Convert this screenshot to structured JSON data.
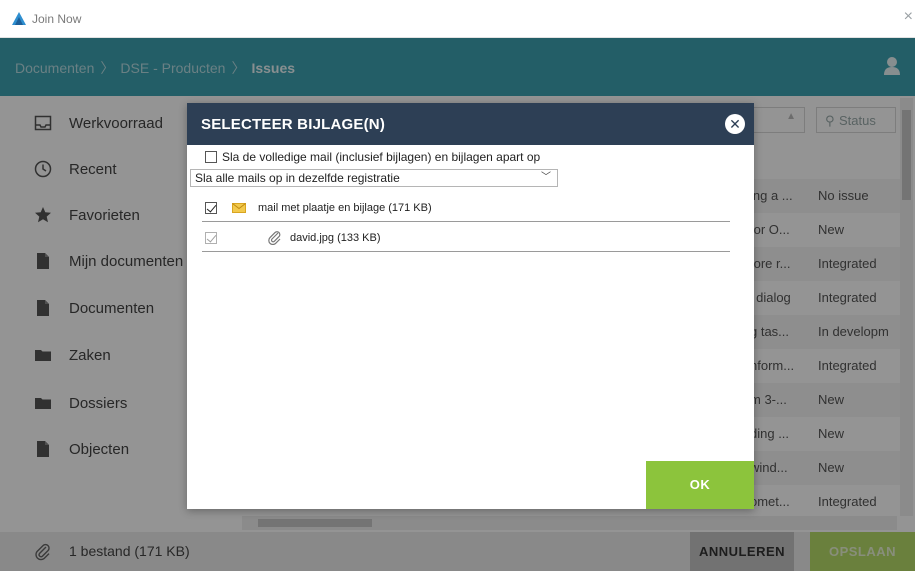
{
  "window": {
    "title": "Join Now"
  },
  "header": {
    "breadcrumb": [
      "Documenten",
      "DSE - Producten",
      "Issues"
    ]
  },
  "sidebar": {
    "items": [
      {
        "label": "Werkvoorraad",
        "icon": "inbox-icon"
      },
      {
        "label": "Recent",
        "icon": "clock-icon"
      },
      {
        "label": "Favorieten",
        "icon": "star-icon"
      },
      {
        "label": "Mijn documenten",
        "icon": "document-icon"
      },
      {
        "label": "Documenten",
        "icon": "document-icon"
      },
      {
        "label": "Zaken",
        "icon": "folder-icon"
      },
      {
        "label": "Dossiers",
        "icon": "folder-icon"
      },
      {
        "label": "Objecten",
        "icon": "document-icon"
      }
    ]
  },
  "filters": {
    "status_placeholder": "Status"
  },
  "list": {
    "rows": [
      {
        "title": "ing a ...",
        "status": "No issue"
      },
      {
        "title": "for O...",
        "status": "New"
      },
      {
        "title": "fore r...",
        "status": "Integrated"
      },
      {
        "title": "' dialog",
        "status": "Integrated"
      },
      {
        "title": "g tas...",
        "status": "In developm"
      },
      {
        "title": "nform...",
        "status": "Integrated"
      },
      {
        "title": "m 3-...",
        "status": "New"
      },
      {
        "title": "ding ...",
        "status": "New"
      },
      {
        "title": "wind...",
        "status": "New"
      },
      {
        "title": "omet...",
        "status": "Integrated"
      }
    ]
  },
  "footer": {
    "files_label": "1 bestand (171 KB)",
    "cancel_label": "ANNULEREN",
    "save_label": "OPSLAAN"
  },
  "modal": {
    "title": "SELECTEER BIJLAGE(N)",
    "save_full_mail_label": "Sla de volledige mail (inclusief bijlagen) en bijlagen apart op",
    "save_full_mail_checked": false,
    "registration_option": "Sla alle mails op in dezelfde registratie",
    "items": [
      {
        "label": "mail met plaatje en bijlage (171 KB)",
        "icon": "envelope-icon",
        "checked": true
      },
      {
        "label": "david.jpg (133 KB)",
        "icon": "paperclip-icon",
        "checked": true,
        "disabled": true
      }
    ],
    "ok_label": "OK"
  },
  "colors": {
    "header": "#3da2b1",
    "modal_header": "#2d3f55",
    "ok_button": "#8cc43c",
    "save_button": "#b7dc6a"
  }
}
